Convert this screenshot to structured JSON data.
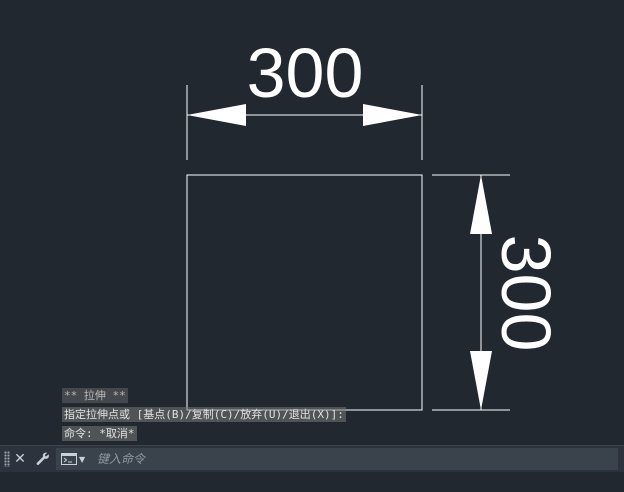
{
  "drawing": {
    "dimensions": {
      "horizontal_value": "300",
      "vertical_value": "300"
    },
    "colors": {
      "background": "#212830",
      "geometry": "#ffffff"
    }
  },
  "command_history": [
    {
      "text": "** 拉伸 **",
      "style": "dim"
    },
    {
      "text": "指定拉伸点或 [基点(B)/复制(C)/放弃(U)/退出(X)]:",
      "style": "normal"
    },
    {
      "text": "命令: *取消*",
      "style": "normal"
    }
  ],
  "command_line": {
    "placeholder": "键入命令",
    "close_icon": "close-icon",
    "settings_icon": "wrench-icon",
    "prompt_icon": "command-prompt-icon"
  }
}
